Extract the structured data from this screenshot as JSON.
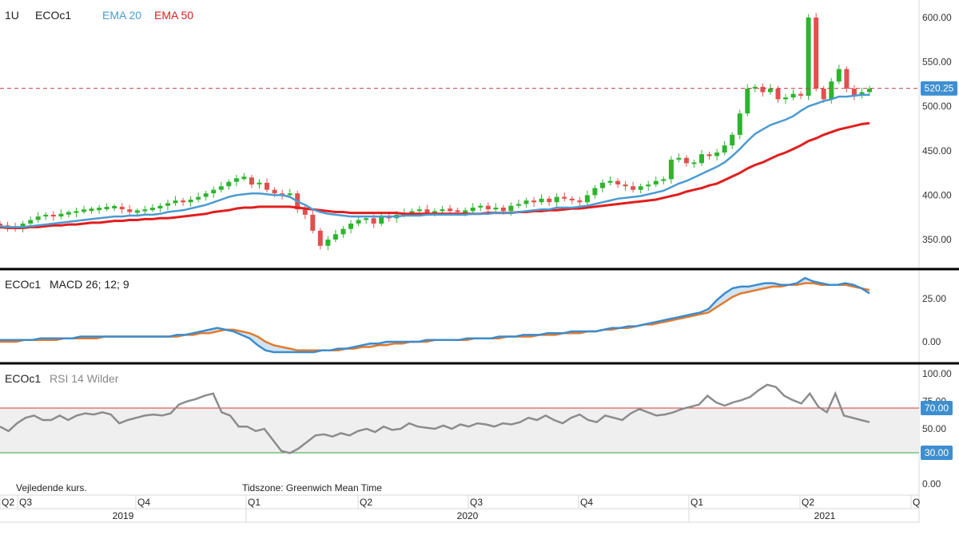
{
  "header": {
    "interval": "1U",
    "symbol": "ECOc1",
    "ema20_label": "EMA 20",
    "ema50_label": "EMA 50"
  },
  "macd_panel": {
    "symbol": "ECOc1",
    "title": "MACD 26; 12; 9"
  },
  "rsi_panel": {
    "symbol": "ECOc1",
    "title": "RSI 14 Wilder"
  },
  "footer": {
    "note_left": "Vejledende kurs.",
    "timezone": "Tidszone: Greenwich Mean Time"
  },
  "colors": {
    "up": "#2db52d",
    "down": "#e0504f",
    "ema20": "#4b9bd1",
    "ema50": "#e01e1e",
    "macd": "#3d8bcb",
    "signal": "#e37a2c",
    "rsi": "#8c8c8c",
    "price_line": "#c94040",
    "rsi_upper": "#d03b3b",
    "rsi_lower": "#37a537",
    "badge": "#3d8fd1"
  },
  "chart_data": [
    {
      "type": "candlestick",
      "title": "",
      "series": [
        {
          "name": "EMA 20"
        },
        {
          "name": "EMA 50"
        }
      ],
      "yticks": [
        "600.00",
        "550.00",
        "500.00",
        "450.00",
        "400.00",
        "350.00"
      ],
      "ylim": [
        325,
        610
      ],
      "last_price": "520.25",
      "x_quarters": [
        "Q2",
        "Q3",
        "Q4",
        "Q1",
        "Q2",
        "Q3",
        "Q4",
        "Q1",
        "Q2",
        "Q"
      ],
      "x_years": [
        "2019",
        "2020",
        "2021"
      ],
      "closes_weekly": [
        366,
        364,
        362,
        368,
        372,
        376,
        378,
        376,
        379,
        380,
        382,
        383,
        384,
        385,
        386,
        387,
        384,
        381,
        382,
        384,
        385,
        388,
        391,
        394,
        392,
        395,
        398,
        402,
        406,
        410,
        415,
        419,
        420,
        412,
        414,
        406,
        402,
        400,
        402,
        384,
        378,
        360,
        343,
        350,
        356,
        362,
        368,
        372,
        374,
        368,
        376,
        374,
        378,
        380,
        382,
        384,
        380,
        382,
        384,
        383,
        381,
        382,
        386,
        388,
        384,
        386,
        382,
        388,
        390,
        394,
        392,
        396,
        392,
        398,
        396,
        394,
        392,
        400,
        408,
        414,
        416,
        412,
        410,
        406,
        410,
        412,
        416,
        418,
        440,
        442,
        436,
        436,
        446,
        444,
        448,
        456,
        468,
        492,
        520,
        522,
        516,
        520,
        508,
        510,
        514,
        512,
        600,
        520,
        508,
        528,
        542,
        520,
        512,
        516,
        520
      ],
      "ema20_weekly": [
        365,
        364,
        364,
        364,
        365,
        366,
        367,
        368,
        369,
        370,
        371,
        372,
        373,
        374,
        375,
        376,
        376,
        377,
        377,
        378,
        378,
        379,
        381,
        382,
        383,
        385,
        387,
        389,
        392,
        395,
        398,
        400,
        401,
        402,
        402,
        401,
        400,
        400,
        398,
        393,
        389,
        384,
        381,
        379,
        378,
        377,
        376,
        376,
        376,
        376,
        376,
        376,
        376,
        377,
        377,
        377,
        378,
        378,
        378,
        378,
        378,
        378,
        379,
        379,
        379,
        380,
        380,
        380,
        381,
        382,
        383,
        384,
        384,
        386,
        386,
        386,
        387,
        388,
        390,
        392,
        394,
        396,
        397,
        398,
        399,
        401,
        403,
        405,
        409,
        413,
        416,
        420,
        424,
        428,
        432,
        437,
        444,
        452,
        461,
        469,
        474,
        479,
        482,
        485,
        489,
        495,
        500,
        503,
        506,
        508,
        511,
        511,
        512,
        513,
        513
      ],
      "ema50_weekly": [
        364,
        363,
        363,
        363,
        364,
        364,
        365,
        366,
        366,
        367,
        367,
        368,
        369,
        369,
        370,
        371,
        371,
        372,
        372,
        373,
        373,
        374,
        374,
        375,
        376,
        377,
        378,
        379,
        381,
        382,
        383,
        385,
        386,
        386,
        387,
        387,
        387,
        387,
        387,
        386,
        385,
        384,
        383,
        382,
        381,
        381,
        380,
        380,
        380,
        380,
        380,
        380,
        380,
        379,
        379,
        379,
        379,
        379,
        379,
        379,
        379,
        379,
        379,
        379,
        380,
        380,
        380,
        380,
        381,
        381,
        382,
        382,
        383,
        383,
        384,
        385,
        385,
        386,
        387,
        388,
        389,
        390,
        391,
        392,
        393,
        394,
        395,
        397,
        399,
        401,
        404,
        406,
        408,
        411,
        413,
        417,
        421,
        425,
        430,
        434,
        437,
        441,
        445,
        448,
        452,
        456,
        461,
        464,
        468,
        471,
        474,
        476,
        478,
        480,
        481
      ]
    },
    {
      "type": "line",
      "title": "",
      "series": [
        {
          "name": "MACD"
        },
        {
          "name": "Signal"
        }
      ],
      "yticks": [
        "25.00",
        "0.00"
      ],
      "ylim": [
        -5,
        40
      ],
      "macd": [
        1,
        1,
        1,
        1,
        1,
        2,
        2,
        2,
        2,
        2,
        3,
        3,
        3,
        3,
        3,
        3,
        3,
        3,
        3,
        3,
        3,
        3,
        4,
        4,
        5,
        6,
        7,
        8,
        7,
        6,
        4,
        2,
        -2,
        -5,
        -6,
        -6,
        -6,
        -6,
        -6,
        -6,
        -5,
        -5,
        -4,
        -4,
        -3,
        -2,
        -1,
        -1,
        0,
        0,
        0,
        0,
        0,
        1,
        1,
        1,
        1,
        1,
        2,
        2,
        2,
        2,
        3,
        3,
        3,
        4,
        4,
        4,
        5,
        5,
        5,
        6,
        6,
        6,
        6,
        7,
        8,
        8,
        9,
        9,
        10,
        11,
        12,
        13,
        14,
        15,
        16,
        17,
        19,
        24,
        28,
        31,
        32,
        32,
        33,
        34,
        34,
        33,
        33,
        34,
        37,
        35,
        34,
        33,
        33,
        34,
        33,
        31,
        28
      ],
      "signal": [
        0,
        0,
        0,
        1,
        1,
        1,
        1,
        1,
        2,
        2,
        2,
        2,
        2,
        3,
        3,
        3,
        3,
        3,
        3,
        3,
        3,
        3,
        3,
        4,
        4,
        5,
        5,
        6,
        7,
        7,
        6,
        5,
        3,
        0,
        -2,
        -3,
        -4,
        -5,
        -5,
        -5,
        -5,
        -5,
        -5,
        -4,
        -4,
        -3,
        -3,
        -2,
        -2,
        -1,
        -1,
        0,
        0,
        0,
        1,
        1,
        1,
        1,
        1,
        2,
        2,
        2,
        2,
        3,
        3,
        3,
        3,
        4,
        4,
        4,
        5,
        5,
        5,
        6,
        6,
        7,
        7,
        8,
        8,
        9,
        10,
        10,
        11,
        12,
        13,
        14,
        15,
        16,
        17,
        20,
        23,
        26,
        28,
        29,
        30,
        31,
        32,
        32,
        33,
        33,
        34,
        34,
        33,
        33,
        33,
        33,
        32,
        31,
        30
      ]
    },
    {
      "type": "line",
      "title": "",
      "series": [
        {
          "name": "RSI 14 Wilder"
        }
      ],
      "yticks": [
        "100.00",
        "75.00",
        "50.00",
        "0.00"
      ],
      "level_labels": [
        "70.00",
        "30.00"
      ],
      "ylim": [
        0,
        100
      ],
      "rsi": [
        52,
        48,
        55,
        60,
        62,
        58,
        58,
        62,
        58,
        62,
        64,
        63,
        65,
        63,
        55,
        58,
        60,
        62,
        63,
        62,
        64,
        72,
        75,
        77,
        80,
        82,
        65,
        62,
        52,
        52,
        48,
        50,
        40,
        30,
        28,
        32,
        38,
        44,
        45,
        43,
        46,
        44,
        48,
        50,
        47,
        52,
        49,
        50,
        55,
        52,
        51,
        50,
        53,
        50,
        54,
        52,
        55,
        54,
        52,
        55,
        54,
        56,
        60,
        58,
        62,
        58,
        55,
        60,
        63,
        58,
        56,
        62,
        60,
        58,
        64,
        68,
        65,
        62,
        63,
        65,
        68,
        70,
        72,
        80,
        74,
        71,
        74,
        76,
        79,
        85,
        90,
        88,
        80,
        76,
        73,
        82,
        70,
        65,
        82,
        62,
        60,
        58,
        56
      ]
    }
  ]
}
